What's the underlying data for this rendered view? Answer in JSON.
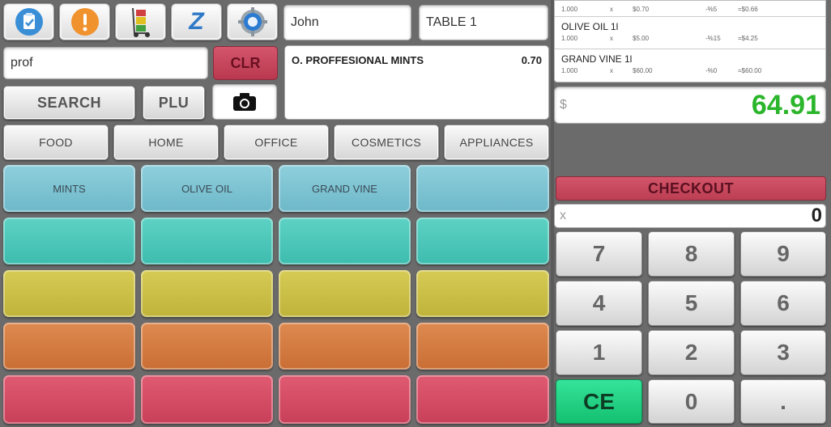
{
  "toolbar": {
    "icons": [
      "clipboard-check-icon",
      "alert-icon",
      "hand-truck-icon",
      "z-report-icon",
      "settings-gear-icon"
    ],
    "z_label": "Z"
  },
  "customer_name": "John",
  "table_name": "TABLE 1",
  "search": {
    "value": "prof",
    "clear_label": "CLR",
    "search_label": "SEARCH",
    "plu_label": "PLU"
  },
  "results": [
    {
      "name": "O. PROFFESIONAL MINTS",
      "price": "0.70"
    }
  ],
  "categories": [
    "FOOD",
    "HOME",
    "OFFICE",
    "COSMETICS",
    "APPLIANCES"
  ],
  "products": [
    "MINTS",
    "OLIVE OIL",
    "GRAND VINE",
    ""
  ],
  "order_lines": [
    {
      "name": "",
      "qty": "1.000",
      "x": "x",
      "price": "$0.70",
      "disc": "-%5",
      "total": "=$0.66"
    },
    {
      "name": "OLIVE OIL 1l",
      "qty": "1.000",
      "x": "x",
      "price": "$5.00",
      "disc": "-%15",
      "total": "=$4.25"
    },
    {
      "name": "GRAND VINE 1l",
      "qty": "1.000",
      "x": "x",
      "price": "$60.00",
      "disc": "-%0",
      "total": "=$60.00"
    }
  ],
  "total": {
    "currency": "$",
    "amount": "64.91"
  },
  "checkout_label": "CHECKOUT",
  "quantity": {
    "prefix": "x",
    "value": "0"
  },
  "keypad": [
    "7",
    "8",
    "9",
    "4",
    "5",
    "6",
    "1",
    "2",
    "3",
    "CE",
    "0",
    "."
  ],
  "colors": {
    "total_green": "#2bb52b",
    "checkout_red": "#c8465c",
    "ce_green": "#1ccf7f"
  }
}
